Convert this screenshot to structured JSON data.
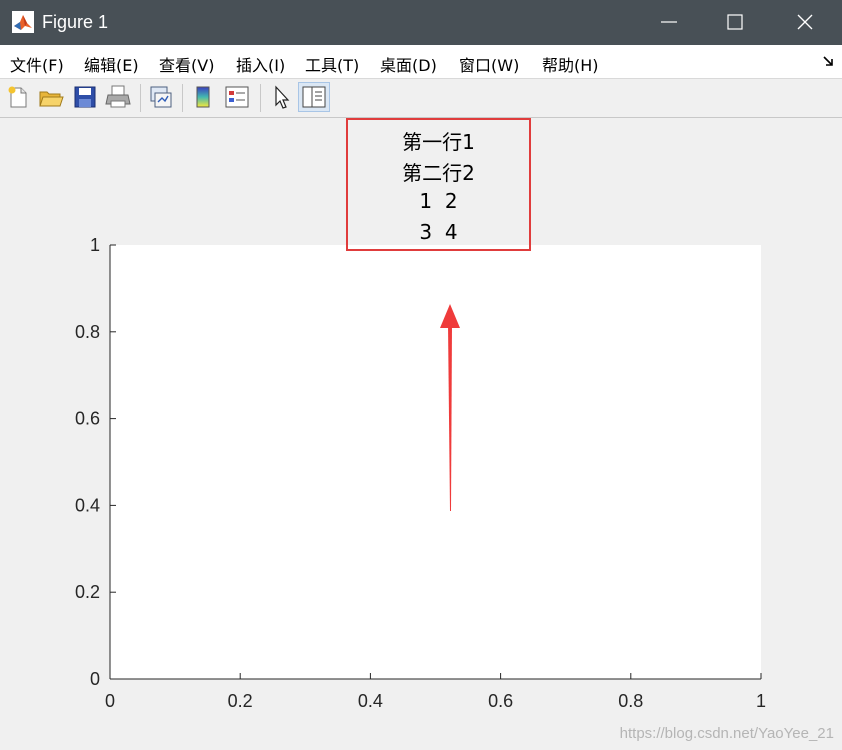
{
  "window": {
    "title": "Figure 1"
  },
  "menu": {
    "items": [
      "文件(F)",
      "编辑(E)",
      "查看(V)",
      "插入(I)",
      "工具(T)",
      "桌面(D)",
      "窗口(W)",
      "帮助(H)"
    ]
  },
  "toolbar": {
    "buttons": [
      "new-figure-icon",
      "open-file-icon",
      "save-icon",
      "print-icon",
      "link-plot-icon",
      "colorbar-icon",
      "legend-icon",
      "pointer-icon",
      "property-editor-icon"
    ],
    "active": "property-editor-icon"
  },
  "plot_title": {
    "lines": [
      "第一行1",
      "第二行2",
      "1  2",
      "3  4"
    ]
  },
  "colors": {
    "highlight": "#e03c3c",
    "arrow": "#ef3b3b",
    "titlebar": "#485056"
  },
  "chart_data": {
    "type": "line",
    "title": "第一行1\n第二行2\n1  2\n3  4",
    "xlim": [
      0,
      1
    ],
    "ylim": [
      0,
      1
    ],
    "xticks": [
      "0",
      "0.2",
      "0.4",
      "0.6",
      "0.8",
      "1"
    ],
    "yticks": [
      "0",
      "0.2",
      "0.4",
      "0.6",
      "0.8",
      "1"
    ],
    "grid": false,
    "series": []
  },
  "watermark": "https://blog.csdn.net/YaoYee_21"
}
